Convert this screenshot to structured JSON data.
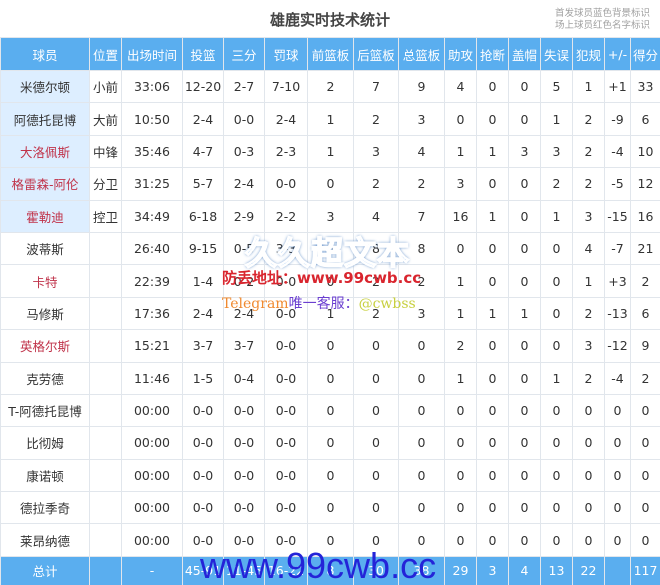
{
  "title": "雄鹿实时技术统计",
  "legend": [
    "首发球员蓝色背景标识",
    "场上球员红色名字标识"
  ],
  "colors": {
    "header_bg": "#5aaeef",
    "starter_bg": "#ddeeff",
    "oncourt_name": "#c0334a"
  },
  "columns": [
    "球员",
    "位置",
    "出场时间",
    "投篮",
    "三分",
    "罚球",
    "前篮板",
    "后篮板",
    "总篮板",
    "助攻",
    "抢断",
    "盖帽",
    "失误",
    "犯规",
    "+/-",
    "得分"
  ],
  "rows": [
    {
      "starter": true,
      "oncourt": false,
      "cells": [
        "米德尔顿",
        "小前",
        "33:06",
        "12-20",
        "2-7",
        "7-10",
        "2",
        "7",
        "9",
        "4",
        "0",
        "0",
        "5",
        "1",
        "+1",
        "33"
      ]
    },
    {
      "starter": true,
      "oncourt": false,
      "cells": [
        "阿德托昆博",
        "大前",
        "10:50",
        "2-4",
        "0-0",
        "2-4",
        "1",
        "2",
        "3",
        "0",
        "0",
        "0",
        "1",
        "2",
        "-9",
        "6"
      ]
    },
    {
      "starter": true,
      "oncourt": true,
      "cells": [
        "大洛佩斯",
        "中锋",
        "35:46",
        "4-7",
        "0-3",
        "2-3",
        "1",
        "3",
        "4",
        "1",
        "1",
        "3",
        "3",
        "2",
        "-4",
        "10"
      ]
    },
    {
      "starter": true,
      "oncourt": true,
      "cells": [
        "格雷森-阿伦",
        "分卫",
        "31:25",
        "5-7",
        "2-4",
        "0-0",
        "0",
        "2",
        "2",
        "3",
        "0",
        "0",
        "2",
        "2",
        "-5",
        "12"
      ]
    },
    {
      "starter": true,
      "oncourt": true,
      "cells": [
        "霍勒迪",
        "控卫",
        "34:49",
        "6-18",
        "2-9",
        "2-2",
        "3",
        "4",
        "7",
        "16",
        "1",
        "0",
        "1",
        "3",
        "-15",
        "16"
      ]
    },
    {
      "starter": false,
      "oncourt": false,
      "cells": [
        "波蒂斯",
        "",
        "26:40",
        "9-15",
        "0-5",
        "3-3",
        "0",
        "8",
        "8",
        "0",
        "0",
        "0",
        "0",
        "4",
        "-7",
        "21"
      ]
    },
    {
      "starter": false,
      "oncourt": true,
      "cells": [
        "卡特",
        "",
        "22:39",
        "1-4",
        "0-2",
        "0-0",
        "0",
        "2",
        "2",
        "1",
        "0",
        "0",
        "0",
        "1",
        "+3",
        "2"
      ]
    },
    {
      "starter": false,
      "oncourt": false,
      "cells": [
        "马修斯",
        "",
        "17:36",
        "2-4",
        "2-4",
        "0-0",
        "1",
        "2",
        "3",
        "1",
        "1",
        "1",
        "0",
        "2",
        "-13",
        "6"
      ]
    },
    {
      "starter": false,
      "oncourt": true,
      "cells": [
        "英格尔斯",
        "",
        "15:21",
        "3-7",
        "3-7",
        "0-0",
        "0",
        "0",
        "0",
        "2",
        "0",
        "0",
        "0",
        "3",
        "-12",
        "9"
      ]
    },
    {
      "starter": false,
      "oncourt": false,
      "cells": [
        "克劳德",
        "",
        "11:46",
        "1-5",
        "0-4",
        "0-0",
        "0",
        "0",
        "0",
        "1",
        "0",
        "0",
        "1",
        "2",
        "-4",
        "2"
      ]
    },
    {
      "starter": false,
      "oncourt": false,
      "cells": [
        "T-阿德托昆博",
        "",
        "00:00",
        "0-0",
        "0-0",
        "0-0",
        "0",
        "0",
        "0",
        "0",
        "0",
        "0",
        "0",
        "0",
        "0",
        "0"
      ]
    },
    {
      "starter": false,
      "oncourt": false,
      "cells": [
        "比彻姆",
        "",
        "00:00",
        "0-0",
        "0-0",
        "0-0",
        "0",
        "0",
        "0",
        "0",
        "0",
        "0",
        "0",
        "0",
        "0",
        "0"
      ]
    },
    {
      "starter": false,
      "oncourt": false,
      "cells": [
        "康诺顿",
        "",
        "00:00",
        "0-0",
        "0-0",
        "0-0",
        "0",
        "0",
        "0",
        "0",
        "0",
        "0",
        "0",
        "0",
        "0",
        "0"
      ]
    },
    {
      "starter": false,
      "oncourt": false,
      "cells": [
        "德拉季奇",
        "",
        "00:00",
        "0-0",
        "0-0",
        "0-0",
        "0",
        "0",
        "0",
        "0",
        "0",
        "0",
        "0",
        "0",
        "0",
        "0"
      ]
    },
    {
      "starter": false,
      "oncourt": false,
      "cells": [
        "莱昂纳德",
        "",
        "00:00",
        "0-0",
        "0-0",
        "0-0",
        "0",
        "0",
        "0",
        "0",
        "0",
        "0",
        "0",
        "0",
        "0",
        "0"
      ]
    }
  ],
  "totals": [
    "总计",
    "",
    "-",
    "45-91",
    "11-45",
    "16-22",
    "8",
    "30",
    "38",
    "29",
    "3",
    "4",
    "13",
    "22",
    "",
    "117"
  ],
  "watermarks": {
    "logo": "久久超文本",
    "address": "防丢地址：www.99cwb.cc",
    "telegram_a": "Telegram",
    "telegram_b": "唯一客服：",
    "telegram_c": "@cwbss",
    "url": "www.99cwb.cc"
  }
}
